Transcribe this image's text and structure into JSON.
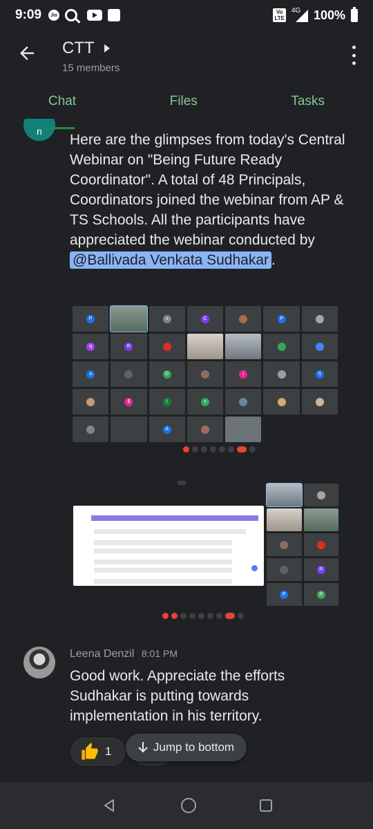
{
  "status_bar": {
    "time": "9:09",
    "network": "4G",
    "battery": "100%",
    "volte": "Vo LTE"
  },
  "header": {
    "title": "CTT",
    "subtitle": "15 members"
  },
  "tabs": [
    {
      "label": "Chat"
    },
    {
      "label": "Files"
    },
    {
      "label": "Tasks"
    }
  ],
  "message1": {
    "text_before": "Here are the glimpses from today's Central Webinar on \"Being Future Ready Coordinator\". A total of 48 Principals, Coordinators joined the webinar from AP & TS Schools. All the participants have appreciated the webinar conducted by ",
    "mention": "@Ballivada Venkata Sudhakar",
    "text_after": "."
  },
  "message2": {
    "sender": "Leena Denzil",
    "time": "8:01 PM",
    "text": "Good work. Appreciate the efforts Sudhakar is putting towards implementation in his territory.",
    "reaction_count": "1"
  },
  "jump_button": {
    "label": "Jump to bottom"
  },
  "colors": {
    "accent_green": "#81c995",
    "mention_bg": "#8ab4f8",
    "background": "#202124"
  },
  "icons": [
    "back-arrow-icon",
    "chevron-right-icon",
    "more-vert-icon",
    "thumbs-up-icon",
    "arrow-down-icon",
    "nav-back-icon",
    "nav-home-icon",
    "nav-recent-icon"
  ]
}
